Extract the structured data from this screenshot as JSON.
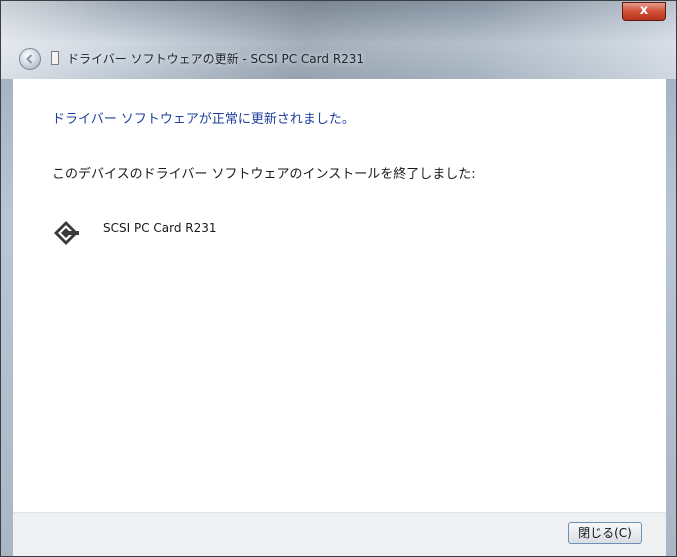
{
  "window": {
    "title": "ドライバー ソフトウェアの更新 - SCSI PC Card R231",
    "close_glyph": "x"
  },
  "content": {
    "heading": "ドライバー ソフトウェアが正常に更新されました。",
    "description": "このデバイスのドライバー ソフトウェアのインストールを終了しました:",
    "device_name": "SCSI PC Card R231",
    "device_icon": "scsi-device-icon"
  },
  "footer": {
    "close_label": "閉じる(C)"
  },
  "colors": {
    "heading": "#1f3f9e",
    "close_button_red": "#d04e34",
    "content_bg": "#ffffff",
    "footer_bg": "#eef0f2"
  }
}
